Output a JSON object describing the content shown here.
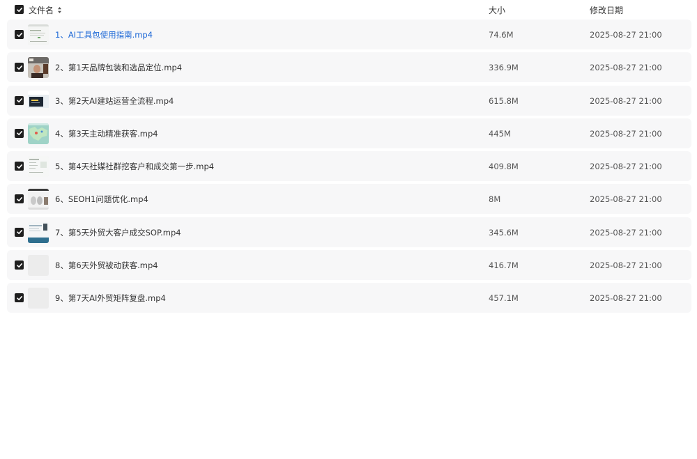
{
  "header": {
    "name_label": "文件名",
    "size_label": "大小",
    "date_label": "修改日期",
    "select_all_checked": true
  },
  "files": [
    {
      "name": "1、AI工具包使用指南.mp4",
      "size": "74.6M",
      "modified": "2025-08-27 21:00",
      "checked": true,
      "thumb": "doc"
    },
    {
      "name": "2、第1天品牌包装和选品定位.mp4",
      "size": "336.9M",
      "modified": "2025-08-27 21:00",
      "checked": true,
      "thumb": "person"
    },
    {
      "name": "3、第2天AI建站运营全流程.mp4",
      "size": "615.8M",
      "modified": "2025-08-27 21:00",
      "checked": true,
      "thumb": "screen"
    },
    {
      "name": "4、第3天主动精准获客.mp4",
      "size": "445M",
      "modified": "2025-08-27 21:00",
      "checked": true,
      "thumb": "map"
    },
    {
      "name": "5、第4天社媒社群挖客户和成交第一步.mp4",
      "size": "409.8M",
      "modified": "2025-08-27 21:00",
      "checked": true,
      "thumb": "doc2"
    },
    {
      "name": "6、SEOH1问题优化.mp4",
      "size": "8M",
      "modified": "2025-08-27 21:00",
      "checked": true,
      "thumb": "products"
    },
    {
      "name": "7、第5天外贸大客户成交SOP.mp4",
      "size": "345.6M",
      "modified": "2025-08-27 21:00",
      "checked": true,
      "thumb": "slide"
    },
    {
      "name": "8、第6天外贸被动获客.mp4",
      "size": "416.7M",
      "modified": "2025-08-27 21:00",
      "checked": true,
      "thumb": "blank"
    },
    {
      "name": "9、第7天AI外贸矩阵复盘.mp4",
      "size": "457.1M",
      "modified": "2025-08-27 21:00",
      "checked": true,
      "thumb": "blank"
    }
  ],
  "colors": {
    "row_bg": "#f7f7f8",
    "active_name": "#1a66d6",
    "text": "#333333",
    "checkbox": "#1f1f1f"
  },
  "icons": {
    "checkbox": "checkmark-icon",
    "sort": "sort-updown-icon"
  }
}
